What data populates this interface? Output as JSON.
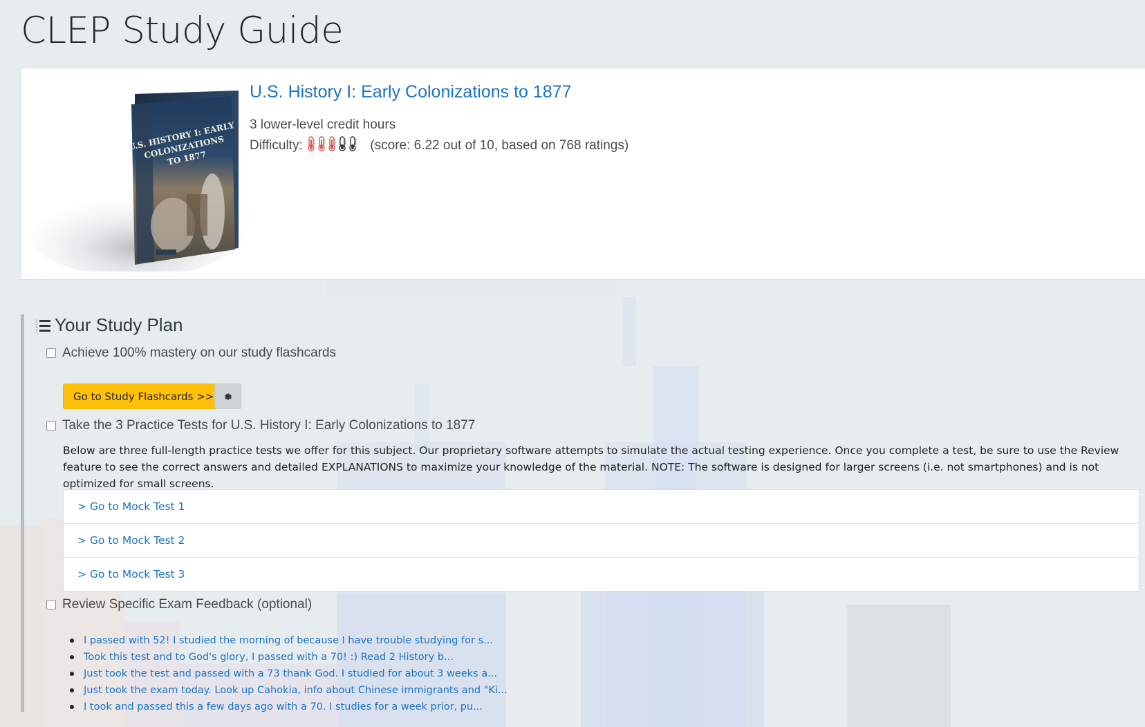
{
  "page": {
    "title": "CLEP Study Guide"
  },
  "course": {
    "title": "U.S. History I: Early Colonizations to 1877",
    "credit_hours": "3 lower-level credit hours",
    "difficulty_label": "Difficulty:",
    "difficulty_filled": 3,
    "difficulty_total": 5,
    "score_text": "(score: 6.22 out of 10, based on 768 ratings)",
    "book_cover": {
      "line1": "U.S. HISTORY I: EARLY",
      "line2": "COLONIZATIONS",
      "line3": "TO 1877"
    }
  },
  "study_plan": {
    "heading": "Your Study Plan",
    "step1": {
      "label": "Achieve 100% mastery on our study flashcards",
      "button_label": "Go to Study Flashcards >>"
    },
    "step2": {
      "label": "Take the 3 Practice Tests for U.S. History I: Early Colonizations to 1877",
      "description": "Below are three full-length practice tests we offer for this subject. Our proprietary software attempts to simulate the actual testing experience. Once you complete a test, be sure to use the Review feature to see the correct answers and detailed EXPLANATIONS to maximize your knowledge of the material. NOTE: The software is designed for larger screens (i.e. not smartphones) and is not optimized for small screens.",
      "mock_tests": [
        "> Go to Mock Test 1",
        "> Go to Mock Test 2",
        "> Go to Mock Test 3"
      ]
    },
    "step3": {
      "label": "Review Specific Exam Feedback (optional)",
      "feedback": [
        "I passed with 52! I studied the morning of because I have trouble studying for s...",
        "Took this test and to God's glory, I passed with a 70! :)  Read 2 History b...",
        "Just took the test and passed with a 73 thank God. I studied for about 3 weeks a...",
        "Just took the exam today. Look up Cahokia, info about Chinese immigrants and \"Ki...",
        "I took and passed this a few days ago with a 70. I studies for a week prior, pu..."
      ]
    }
  },
  "colors": {
    "link": "#1a73c8",
    "button_primary": "#ffc107",
    "background": "#e7ecef",
    "thermo_hot": "#d9534f",
    "thermo_cold": "#333333"
  }
}
